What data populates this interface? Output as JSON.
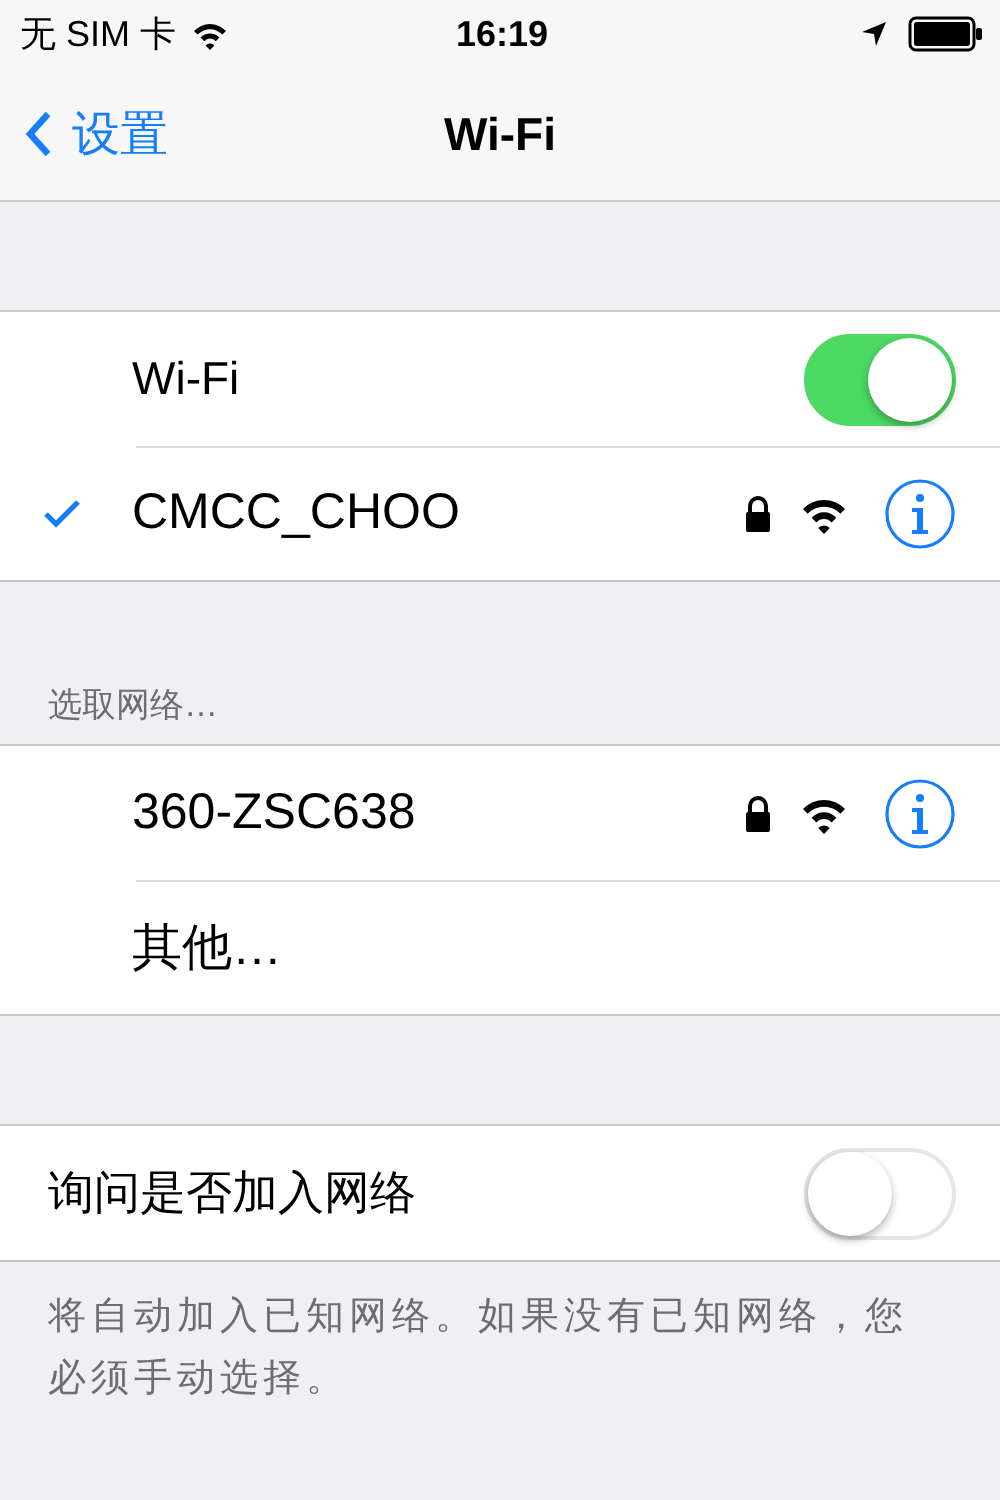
{
  "status_bar": {
    "carrier": "无 SIM 卡",
    "time": "16:19"
  },
  "nav": {
    "back_label": "设置",
    "title": "Wi-Fi"
  },
  "wifi_section": [
    {
      "kind": "toggle",
      "label": "Wi-Fi",
      "on": true
    },
    {
      "kind": "network",
      "label": "CMCC_CHOO",
      "selected": true,
      "secured": true
    }
  ],
  "choose_header": "选取网络…",
  "networks": [
    {
      "kind": "network",
      "label": "360-ZSC638",
      "selected": false,
      "secured": true
    },
    {
      "kind": "other",
      "label": "其他…"
    }
  ],
  "ask_section": [
    {
      "kind": "toggle",
      "label": "询问是否加入网络",
      "on": false,
      "inset": false
    }
  ],
  "footer": "将自动加入已知网络。如果没有已知网络，您必须手动选择。"
}
